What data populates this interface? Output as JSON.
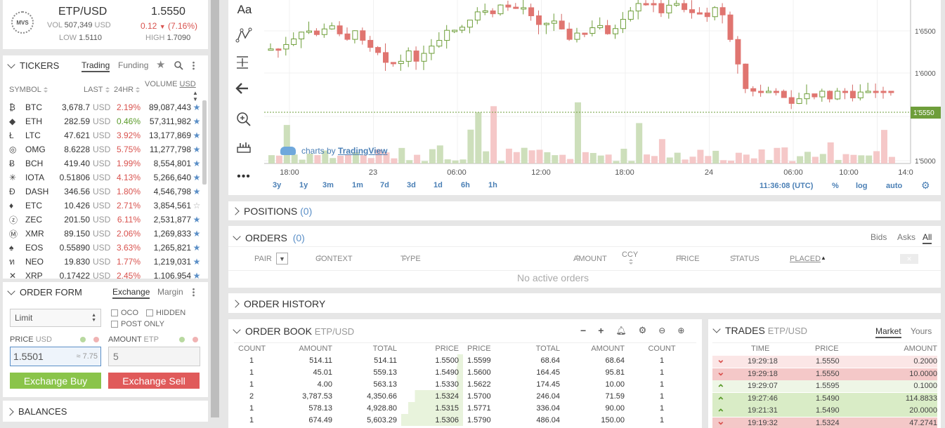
{
  "ticker": {
    "logo": "MVS",
    "pair_base": "ETP",
    "pair_quote": "USD",
    "price": "1.5550",
    "vol_label": "VOL",
    "vol_value": "507,349",
    "vol_unit": "USD",
    "change": "0.12",
    "change_pct": "(7.16%)",
    "low_label": "LOW",
    "low_value": "1.5110",
    "high_label": "HIGH",
    "high_value": "1.7090"
  },
  "tickers_panel": {
    "title": "TICKERS",
    "tab_trading": "Trading",
    "tab_funding": "Funding",
    "col_symbol": "SYMBOL",
    "col_last": "LAST",
    "col_24hr": "24HR",
    "col_volume": "VOLUME",
    "col_volume_unit": "USD",
    "rows": [
      {
        "icon": "₿",
        "symbol": "BTC",
        "last": "3,678.7",
        "unit": "USD",
        "chg": "2.19%",
        "up": false,
        "vol": "89,087,443",
        "fav": true
      },
      {
        "icon": "◆",
        "symbol": "ETH",
        "last": "282.59",
        "unit": "USD",
        "chg": "0.46%",
        "up": true,
        "vol": "57,311,982",
        "fav": true
      },
      {
        "icon": "Ł",
        "symbol": "LTC",
        "last": "47.621",
        "unit": "USD",
        "chg": "3.92%",
        "up": false,
        "vol": "13,177,869",
        "fav": true
      },
      {
        "icon": "◎",
        "symbol": "OMG",
        "last": "8.6228",
        "unit": "USD",
        "chg": "5.75%",
        "up": false,
        "vol": "11,277,798",
        "fav": true
      },
      {
        "icon": "Ƀ",
        "symbol": "BCH",
        "last": "419.40",
        "unit": "USD",
        "chg": "1.99%",
        "up": false,
        "vol": "8,554,801",
        "fav": true
      },
      {
        "icon": "✳",
        "symbol": "IOTA",
        "last": "0.51806",
        "unit": "USD",
        "chg": "4.13%",
        "up": false,
        "vol": "5,266,640",
        "fav": true
      },
      {
        "icon": "Đ",
        "symbol": "DASH",
        "last": "346.56",
        "unit": "USD",
        "chg": "1.80%",
        "up": false,
        "vol": "4,546,798",
        "fav": true
      },
      {
        "icon": "♦",
        "symbol": "ETC",
        "last": "10.426",
        "unit": "USD",
        "chg": "2.71%",
        "up": false,
        "vol": "3,854,561",
        "fav": false
      },
      {
        "icon": "ⓩ",
        "symbol": "ZEC",
        "last": "201.50",
        "unit": "USD",
        "chg": "6.11%",
        "up": false,
        "vol": "2,531,877",
        "fav": true
      },
      {
        "icon": "Ⓜ",
        "symbol": "XMR",
        "last": "89.150",
        "unit": "USD",
        "chg": "2.06%",
        "up": false,
        "vol": "1,269,833",
        "fav": true
      },
      {
        "icon": "♠",
        "symbol": "EOS",
        "last": "0.55890",
        "unit": "USD",
        "chg": "3.63%",
        "up": false,
        "vol": "1,265,821",
        "fav": true
      },
      {
        "icon": "ท",
        "symbol": "NEO",
        "last": "19.830",
        "unit": "USD",
        "chg": "1.77%",
        "up": false,
        "vol": "1,219,031",
        "fav": true
      },
      {
        "icon": "✕",
        "symbol": "XRP",
        "last": "0.17422",
        "unit": "USD",
        "chg": "2.45%",
        "up": false,
        "vol": "1,106,954",
        "fav": true
      }
    ]
  },
  "order_form": {
    "title": "ORDER FORM",
    "tab_exchange": "Exchange",
    "tab_margin": "Margin",
    "type_value": "Limit",
    "oco": "OCO",
    "hidden": "HIDDEN",
    "post_only": "POST ONLY",
    "price_label": "PRICE",
    "price_unit": "USD",
    "amount_label": "AMOUNT",
    "amount_unit": "ETP",
    "price_value": "1.5501",
    "price_hint": "≈ 7.75",
    "amount_value": "5",
    "buy_label": "Exchange Buy",
    "sell_label": "Exchange Sell"
  },
  "balances": {
    "title": "BALANCES"
  },
  "chart": {
    "watermark_prefix": "charts by",
    "watermark_brand": "TradingView",
    "x_labels": [
      "18:00",
      "23",
      "06:00",
      "12:00",
      "18:00",
      "24",
      "06:00",
      "10:00",
      "14:0"
    ],
    "y_labels": [
      "1'6500",
      "1'6000",
      "1'5000"
    ],
    "price_marker": "1'5550",
    "ranges": [
      "3y",
      "1y",
      "3m",
      "1m",
      "7d",
      "3d",
      "1d",
      "6h",
      "1h"
    ],
    "time": "11:36:08 (UTC)",
    "pct": "%",
    "log": "log",
    "auto": "auto",
    "tool_text": "Aa"
  },
  "chart_data": {
    "type": "candlestick",
    "x": [
      "18:00",
      "23",
      "06:00",
      "12:00",
      "18:00",
      "24",
      "06:00",
      "10:00",
      "14:0"
    ],
    "y_ticks": [
      1.65,
      1.6,
      1.5
    ],
    "last_price": 1.555
  },
  "positions": {
    "title": "POSITIONS",
    "count": "(0)"
  },
  "orders": {
    "title": "ORDERS",
    "count": "(0)",
    "tab_bids": "Bids",
    "tab_asks": "Asks",
    "tab_all": "All",
    "cols": [
      "PAIR",
      "CONTEXT",
      "TYPE",
      "AMOUNT",
      "CCY",
      "PRICE",
      "STATUS",
      "PLACED"
    ],
    "empty": "No active orders"
  },
  "order_history": {
    "title": "ORDER HISTORY"
  },
  "order_book": {
    "title": "ORDER BOOK",
    "pair": "ETP/USD",
    "bid_cols": [
      "COUNT",
      "AMOUNT",
      "TOTAL",
      "PRICE"
    ],
    "ask_cols": [
      "PRICE",
      "TOTAL",
      "AMOUNT",
      "COUNT"
    ],
    "bids": [
      {
        "count": "1",
        "amount": "514.11",
        "total": "514.11",
        "price": "1.5500",
        "depth": 0.08
      },
      {
        "count": "1",
        "amount": "45.01",
        "total": "559.13",
        "price": "1.5490",
        "depth": 0.09
      },
      {
        "count": "1",
        "amount": "4.00",
        "total": "563.13",
        "price": "1.5330",
        "depth": 0.09
      },
      {
        "count": "2",
        "amount": "3,787.53",
        "total": "4,350.66",
        "price": "1.5324",
        "depth": 0.7
      },
      {
        "count": "1",
        "amount": "578.13",
        "total": "4,928.80",
        "price": "1.5315",
        "depth": 0.8
      },
      {
        "count": "1",
        "amount": "674.49",
        "total": "5,603.29",
        "price": "1.5306",
        "depth": 0.9
      }
    ],
    "asks": [
      {
        "price": "1.5599",
        "total": "68.64",
        "amount": "68.64",
        "count": "1"
      },
      {
        "price": "1.5600",
        "total": "164.45",
        "amount": "95.81",
        "count": "1"
      },
      {
        "price": "1.5622",
        "total": "174.45",
        "amount": "10.00",
        "count": "1"
      },
      {
        "price": "1.5700",
        "total": "246.04",
        "amount": "71.59",
        "count": "1"
      },
      {
        "price": "1.5771",
        "total": "336.04",
        "amount": "90.00",
        "count": "1"
      },
      {
        "price": "1.5790",
        "total": "486.04",
        "amount": "150.00",
        "count": "1"
      }
    ]
  },
  "trades": {
    "title": "TRADES",
    "pair": "ETP/USD",
    "tab_market": "Market",
    "tab_yours": "Yours",
    "cols": [
      "TIME",
      "PRICE",
      "AMOUNT"
    ],
    "rows": [
      {
        "dir": "down",
        "time": "19:29:18",
        "price": "1.5550",
        "amount": "0.2000",
        "depth": 0.05
      },
      {
        "dir": "down",
        "time": "19:29:18",
        "price": "1.5550",
        "amount": "10.0000",
        "depth": 1.0
      },
      {
        "dir": "up",
        "time": "19:29:07",
        "price": "1.5595",
        "amount": "0.1000",
        "depth": 0.04
      },
      {
        "dir": "up",
        "time": "19:27:46",
        "price": "1.5490",
        "amount": "114.8833",
        "depth": 1.0
      },
      {
        "dir": "up",
        "time": "19:21:31",
        "price": "1.5490",
        "amount": "20.0000",
        "depth": 1.0
      },
      {
        "dir": "down",
        "time": "19:19:32",
        "price": "1.5324",
        "amount": "47.2741",
        "depth": 1.0
      }
    ]
  }
}
